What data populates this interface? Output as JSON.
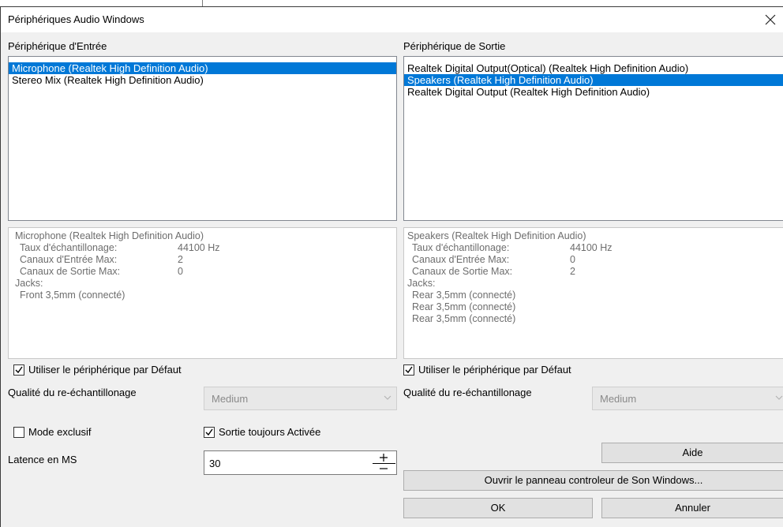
{
  "window": {
    "title": "Périphériques Audio Windows"
  },
  "input": {
    "heading": "Périphérique d'Entrée",
    "devices": [
      "Microphone (Realtek High Definition Audio)",
      "Stereo Mix (Realtek High Definition Audio)"
    ],
    "selected_index": 0,
    "info": {
      "device": "Microphone (Realtek High Definition Audio)",
      "rows": [
        {
          "label": "Taux d'échantillonage:",
          "value": "44100 Hz"
        },
        {
          "label": "Canaux d'Entrée Max:",
          "value": "2"
        },
        {
          "label": "Canaux de Sortie Max:",
          "value": "0"
        }
      ],
      "jacks_label": "Jacks:",
      "jacks": [
        "Front 3,5mm (connecté)"
      ]
    },
    "use_default": {
      "label": "Utiliser le périphérique par Défaut",
      "checked": true
    },
    "quality": {
      "label": "Qualité du re-échantillonage",
      "value": "Medium"
    }
  },
  "output": {
    "heading": "Périphérique de Sortie",
    "devices": [
      "Realtek Digital Output(Optical) (Realtek High Definition Audio)",
      "Speakers (Realtek High Definition Audio)",
      "Realtek Digital Output (Realtek High Definition Audio)"
    ],
    "selected_index": 1,
    "info": {
      "device": "Speakers (Realtek High Definition Audio)",
      "rows": [
        {
          "label": "Taux d'échantillonage:",
          "value": "44100 Hz"
        },
        {
          "label": "Canaux d'Entrée Max:",
          "value": "0"
        },
        {
          "label": "Canaux de Sortie Max:",
          "value": "2"
        }
      ],
      "jacks_label": "Jacks:",
      "jacks": [
        "Rear 3,5mm (connecté)",
        "Rear 3,5mm (connecté)",
        "Rear 3,5mm (connecté)"
      ]
    },
    "use_default": {
      "label": "Utiliser le périphérique par Défaut",
      "checked": true
    },
    "quality": {
      "label": "Qualité du re-échantillonage",
      "value": "Medium"
    }
  },
  "options": {
    "exclusive": {
      "label": "Mode exclusif",
      "checked": false
    },
    "always_on": {
      "label": "Sortie toujours Activée",
      "checked": true
    },
    "latency": {
      "label": "Latence en MS",
      "value": "30"
    }
  },
  "buttons": {
    "help": "Aide",
    "open_panel": "Ouvrir le panneau controleur de Son Windows...",
    "ok": "OK",
    "cancel": "Annuler"
  },
  "colors": {
    "selection": "#0078d7",
    "dialog_bg": "#f0f0f0",
    "disabled_text": "#6d6d6d"
  }
}
